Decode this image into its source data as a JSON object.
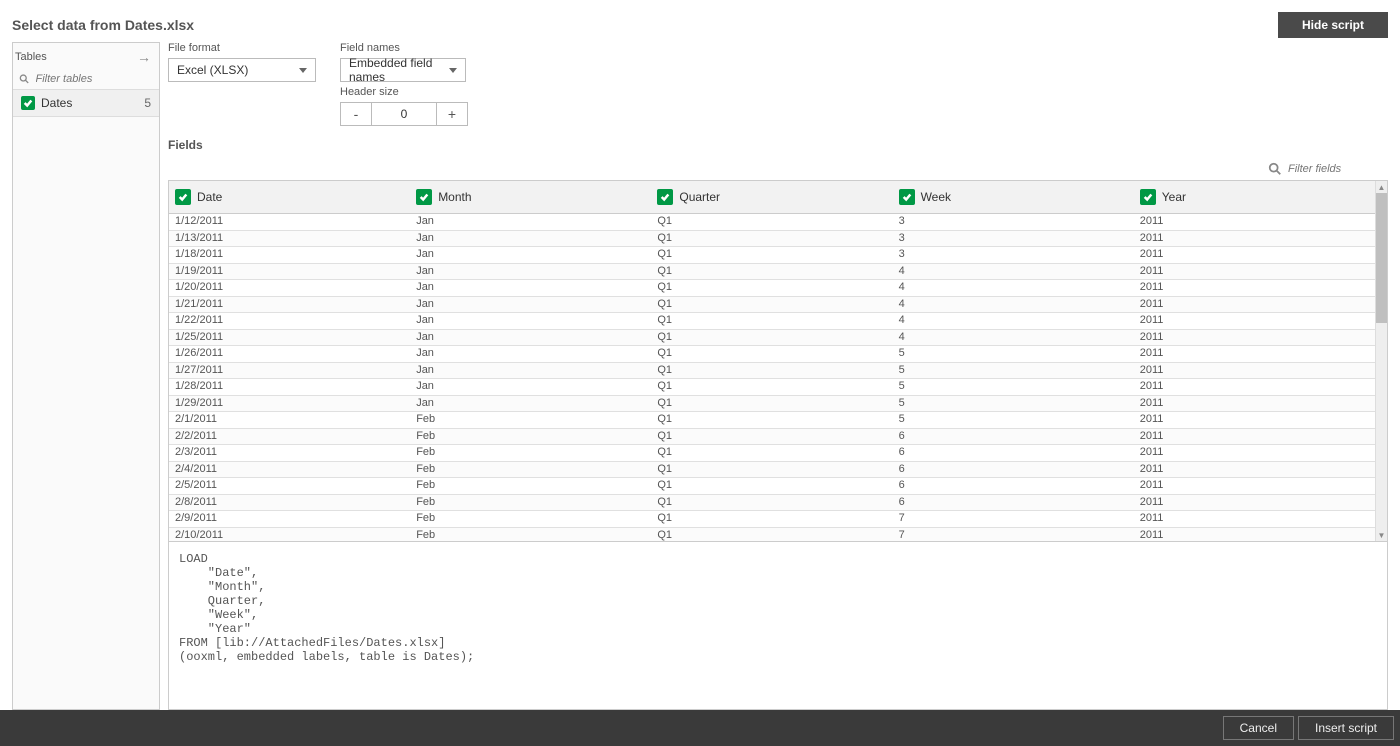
{
  "header": {
    "title": "Select data from Dates.xlsx",
    "hide_script_label": "Hide script"
  },
  "sidebar": {
    "label": "Tables",
    "filter_placeholder": "Filter tables",
    "table_item": {
      "name": "Dates",
      "count": "5"
    }
  },
  "controls": {
    "file_format": {
      "label": "File format",
      "value": "Excel (XLSX)"
    },
    "field_names": {
      "label": "Field names",
      "value": "Embedded field names"
    },
    "header_size": {
      "label": "Header size",
      "value": "0",
      "minus": "-",
      "plus": "+"
    }
  },
  "fields": {
    "label": "Fields",
    "filter_placeholder": "Filter fields",
    "columns": [
      "Date",
      "Month",
      "Quarter",
      "Week",
      "Year"
    ],
    "rows": [
      [
        "1/12/2011",
        "Jan",
        "Q1",
        "3",
        "2011"
      ],
      [
        "1/13/2011",
        "Jan",
        "Q1",
        "3",
        "2011"
      ],
      [
        "1/18/2011",
        "Jan",
        "Q1",
        "3",
        "2011"
      ],
      [
        "1/19/2011",
        "Jan",
        "Q1",
        "4",
        "2011"
      ],
      [
        "1/20/2011",
        "Jan",
        "Q1",
        "4",
        "2011"
      ],
      [
        "1/21/2011",
        "Jan",
        "Q1",
        "4",
        "2011"
      ],
      [
        "1/22/2011",
        "Jan",
        "Q1",
        "4",
        "2011"
      ],
      [
        "1/25/2011",
        "Jan",
        "Q1",
        "4",
        "2011"
      ],
      [
        "1/26/2011",
        "Jan",
        "Q1",
        "5",
        "2011"
      ],
      [
        "1/27/2011",
        "Jan",
        "Q1",
        "5",
        "2011"
      ],
      [
        "1/28/2011",
        "Jan",
        "Q1",
        "5",
        "2011"
      ],
      [
        "1/29/2011",
        "Jan",
        "Q1",
        "5",
        "2011"
      ],
      [
        "2/1/2011",
        "Feb",
        "Q1",
        "5",
        "2011"
      ],
      [
        "2/2/2011",
        "Feb",
        "Q1",
        "6",
        "2011"
      ],
      [
        "2/3/2011",
        "Feb",
        "Q1",
        "6",
        "2011"
      ],
      [
        "2/4/2011",
        "Feb",
        "Q1",
        "6",
        "2011"
      ],
      [
        "2/5/2011",
        "Feb",
        "Q1",
        "6",
        "2011"
      ],
      [
        "2/8/2011",
        "Feb",
        "Q1",
        "6",
        "2011"
      ],
      [
        "2/9/2011",
        "Feb",
        "Q1",
        "7",
        "2011"
      ],
      [
        "2/10/2011",
        "Feb",
        "Q1",
        "7",
        "2011"
      ]
    ]
  },
  "script": "LOAD\n    \"Date\",\n    \"Month\",\n    Quarter,\n    \"Week\",\n    \"Year\"\nFROM [lib://AttachedFiles/Dates.xlsx]\n(ooxml, embedded labels, table is Dates);",
  "footer": {
    "cancel": "Cancel",
    "insert": "Insert script"
  }
}
